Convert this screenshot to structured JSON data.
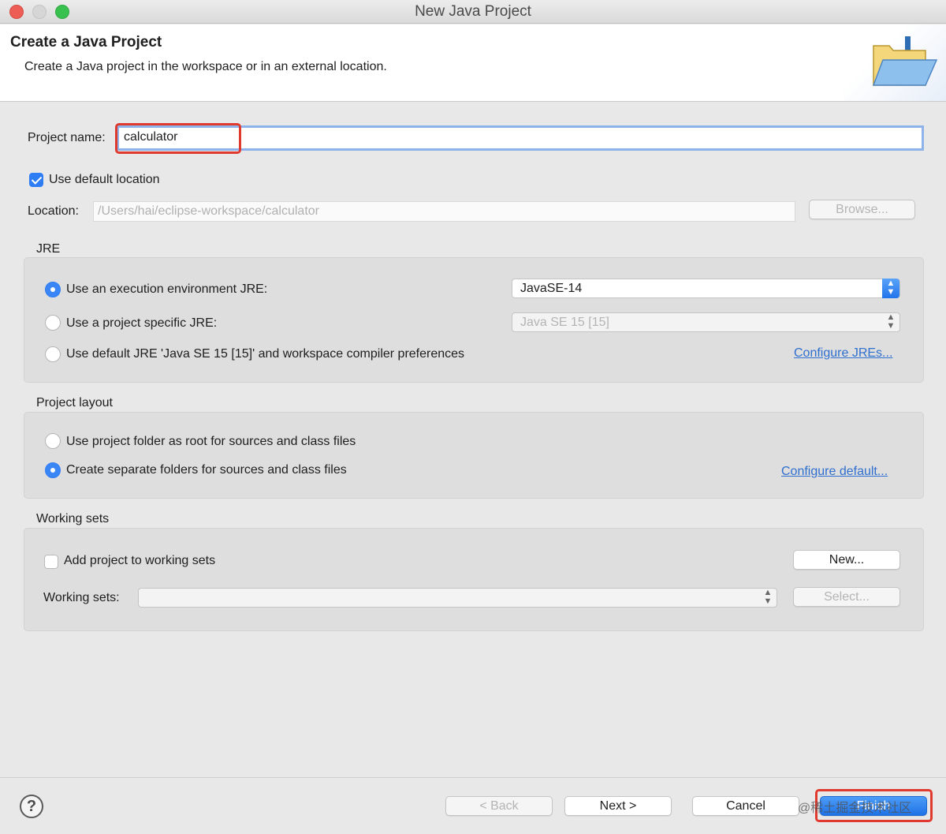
{
  "window": {
    "title": "New Java Project"
  },
  "header": {
    "title": "Create a Java Project",
    "description": "Create a Java project in the workspace or in an external location."
  },
  "project_name": {
    "label": "Project name:",
    "value": "calculator"
  },
  "default_location": {
    "label": "Use default location",
    "checked": true
  },
  "location": {
    "label": "Location:",
    "value": "/Users/hai/eclipse-workspace/calculator",
    "browse_label": "Browse..."
  },
  "jre": {
    "title": "JRE",
    "options": [
      {
        "label": "Use an execution environment JRE:",
        "selected": true
      },
      {
        "label": "Use a project specific JRE:",
        "selected": false
      },
      {
        "label": "Use default JRE 'Java SE 15 [15]' and workspace compiler preferences",
        "selected": false
      }
    ],
    "environment_select": "JavaSE-14",
    "project_select": "Java SE 15 [15]",
    "configure_link": "Configure JREs..."
  },
  "layout": {
    "title": "Project layout",
    "options": [
      {
        "label": "Use project folder as root for sources and class files",
        "selected": false
      },
      {
        "label": "Create separate folders for sources and class files",
        "selected": true
      }
    ],
    "configure_link": "Configure default..."
  },
  "working_sets": {
    "title": "Working sets",
    "add_label": "Add project to working sets",
    "add_checked": false,
    "new_label": "New...",
    "sets_label": "Working sets:",
    "sets_value": "",
    "select_label": "Select..."
  },
  "footer": {
    "help": "?",
    "back_label": "< Back",
    "next_label": "Next >",
    "cancel_label": "Cancel",
    "finish_label": "Finish",
    "watermark": "@稀土掘金技术社区"
  },
  "colors": {
    "accent": "#2f7df5",
    "highlight": "#e03a2f",
    "link": "#2f6fcf"
  }
}
